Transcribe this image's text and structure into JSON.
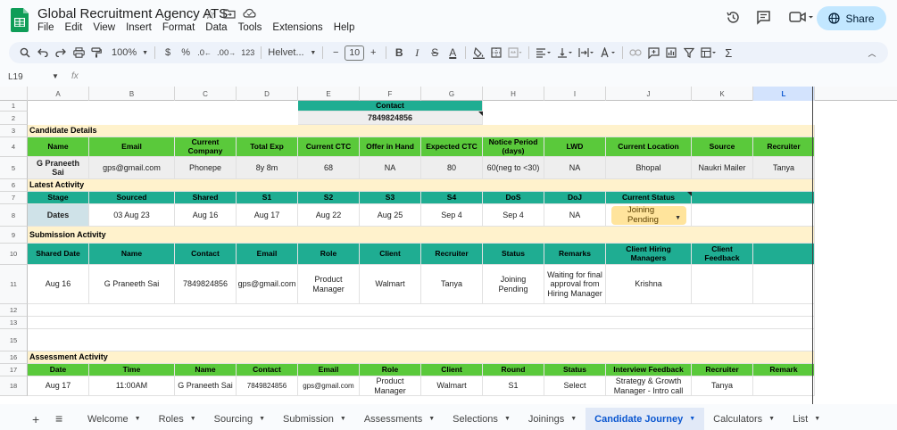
{
  "app": {
    "title": "Global Recruitment Agency ATS",
    "menu": [
      "File",
      "Edit",
      "View",
      "Insert",
      "Format",
      "Data",
      "Tools",
      "Extensions",
      "Help"
    ],
    "share_label": "Share"
  },
  "toolbar": {
    "zoom": "100%",
    "currency": "$",
    "percent": "%",
    "dec_decrease": ".0",
    "dec_increase": ".00",
    "number_format": "123",
    "font": "Helvet...",
    "font_size": "10"
  },
  "formula": {
    "cell_ref": "L19",
    "fx": "fx",
    "value": ""
  },
  "grid": {
    "columns": [
      "A",
      "B",
      "C",
      "D",
      "E",
      "F",
      "G",
      "H",
      "I",
      "J",
      "K",
      "L"
    ],
    "selected_column": "L",
    "rows": [
      "1",
      "2",
      "3",
      "4",
      "5",
      "6",
      "7",
      "8",
      "9",
      "10",
      "11",
      "12",
      "13",
      "15",
      "16",
      "17",
      "18"
    ],
    "contact_header": "Contact",
    "contact_value": "7849824856",
    "candidate_section": "Candidate Details",
    "candidate_headers": [
      "Name",
      "Email",
      "Current Company",
      "Total Exp",
      "Current CTC",
      "Offer in Hand",
      "Expected CTC",
      "Notice Period (days)",
      "LWD",
      "Current Location",
      "Source",
      "Recruiter"
    ],
    "candidate_row": [
      "G Praneeth Sai",
      "gps@gmail.com",
      "Phonepe",
      "8y 8m",
      "68",
      "NA",
      "80",
      "60(neg to <30)",
      "NA",
      "Bhopal",
      "Naukri Mailer",
      "Tanya"
    ],
    "activity_section": "Latest Activity",
    "activity_headers": [
      "Stage",
      "Sourced",
      "Shared",
      "S1",
      "S2",
      "S3",
      "S4",
      "DoS",
      "DoJ",
      "Current Status"
    ],
    "activity_row": [
      "Dates",
      "03 Aug 23",
      "Aug 16",
      "Aug 17",
      "Aug 22",
      "Aug 25",
      "Sep 4",
      "Sep 4",
      "NA"
    ],
    "current_status": "Joining Pending",
    "submission_section": "Submission Activity",
    "submission_headers": [
      "Shared Date",
      "Name",
      "Contact",
      "Email",
      "Role",
      "Client",
      "Recruiter",
      "Status",
      "Remarks",
      "Client Hiring Managers",
      "Client Feedback"
    ],
    "submission_row": [
      "Aug 16",
      "G Praneeth Sai",
      "7849824856",
      "gps@gmail.com",
      "Product Manager",
      "Walmart",
      "Tanya",
      "Joining Pending",
      "Waiting for final approval from Hiring Manager",
      "Krishna",
      ""
    ],
    "assessment_section": "Assessment Activity",
    "assessment_headers": [
      "Date",
      "Time",
      "Name",
      "Contact",
      "Email",
      "Role",
      "Client",
      "Round",
      "Status",
      "Interview Feedback",
      "Recruiter",
      "Remark"
    ],
    "assessment_row": [
      "Aug 17",
      "11:00AM",
      "G Praneeth Sai",
      "7849824856",
      "gps@gmail.com",
      "Product Manager",
      "Walmart",
      "S1",
      "Select",
      "Strategy & Growth Manager - Intro call",
      "Tanya",
      ""
    ]
  },
  "sheets": {
    "tabs": [
      "Welcome",
      "Roles",
      "Sourcing",
      "Submission",
      "Assessments",
      "Selections",
      "Joinings",
      "Candidate Journey",
      "Calculators",
      "List"
    ],
    "active": "Candidate Journey"
  },
  "colors": {
    "header_green": "#5ac93b",
    "header_teal": "#1fad92",
    "section_yellow": "#fff2cc",
    "status_chip": "#ffe49c",
    "share_button": "#c2e7ff"
  }
}
